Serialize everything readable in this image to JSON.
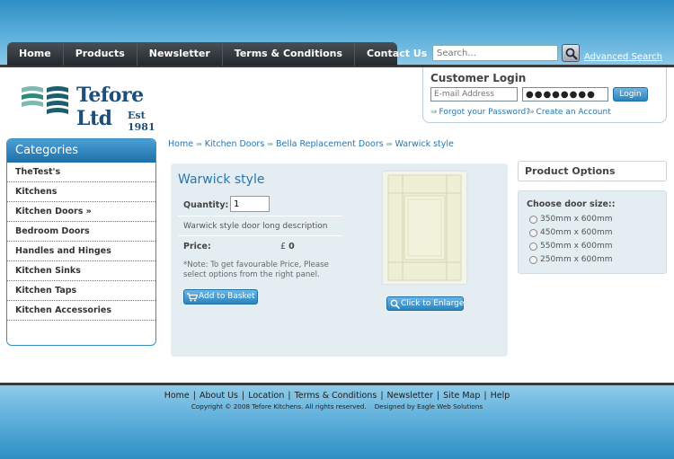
{
  "nav": {
    "items": [
      "Home",
      "Products",
      "Newsletter",
      "Terms & Conditions",
      "Contact Us"
    ]
  },
  "search": {
    "placeholder": "Search...",
    "advanced_label": "Advanced Search"
  },
  "logo": {
    "name": "Tefore Ltd",
    "est": "Est 1981"
  },
  "login": {
    "title": "Customer Login",
    "email_placeholder": "E-mail Address",
    "password_value": "●●●●●●●●",
    "button_label": "Login",
    "forgot_label": "Forgot your Password?",
    "create_label": "Create an Account"
  },
  "categories": {
    "title": "Categories",
    "items": [
      "TheTest's",
      "Kitchens",
      "Kitchen Doors »",
      "Bedroom Doors",
      "Handles and Hinges",
      "Kitchen Sinks",
      "Kitchen Taps",
      "Kitchen Accessories"
    ]
  },
  "breadcrumb": [
    "Home",
    "Kitchen Doors",
    "Bella Replacement Doors",
    "Warwick style"
  ],
  "product": {
    "title": "Warwick style",
    "quantity_label": "Quantity:",
    "quantity_value": "1",
    "description": "Warwick style door long description",
    "price_label": "Price:",
    "price_currency": "£",
    "price_value": "0",
    "note": "*Note: To get favourable Price, Please select options from the right panel.",
    "basket_label": "Add to Basket",
    "enlarge_label": "Click to Enlarge"
  },
  "options": {
    "header": "Product Options",
    "title": "Choose door size::",
    "sizes": [
      "350mm x 600mm",
      "450mm x 600mm",
      "550mm x 600mm",
      "250mm x 600mm"
    ]
  },
  "footer": {
    "links": [
      "Home",
      "About Us",
      "Location",
      "Terms & Conditions",
      "Newsletter",
      "Site Map",
      "Help"
    ],
    "copyright": "Copyright © 2008 Tefore Kitchens. All rights reserved.    Designed by Eagle Web Solutions"
  },
  "colors": {
    "accent": "#2a76ad",
    "brand": "#1d4e7a",
    "panel": "#e4edf2"
  }
}
